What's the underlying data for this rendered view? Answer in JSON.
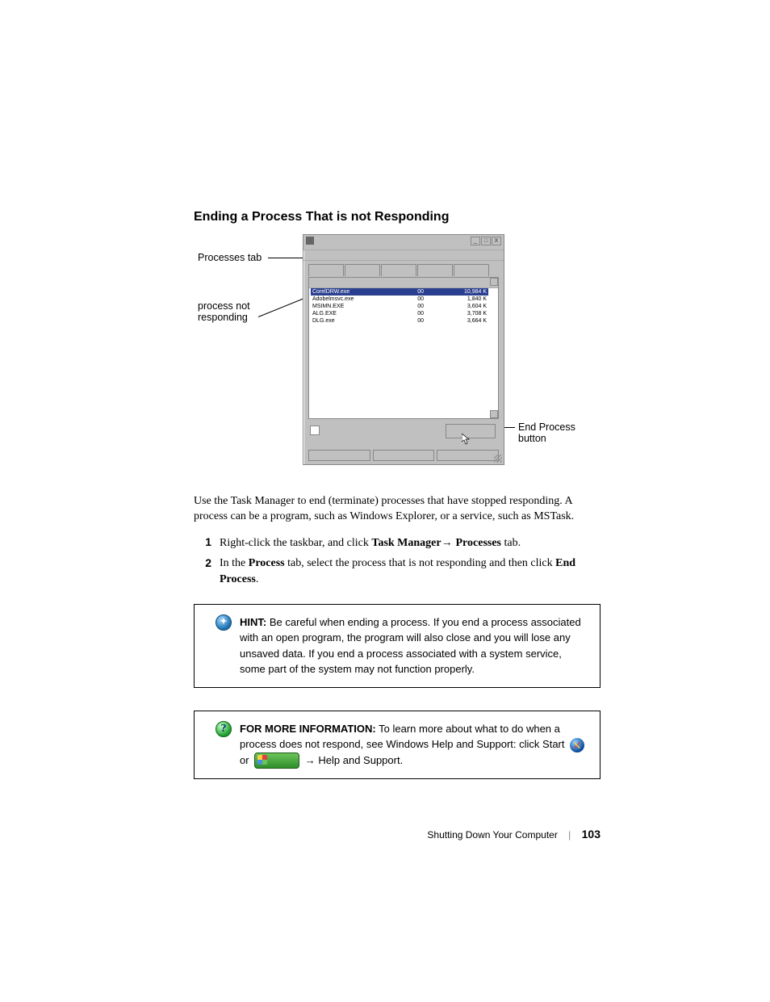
{
  "section_title": "Ending a Process That is not Responding",
  "callouts": {
    "processes_tab": "Processes tab",
    "process_not_responding_l1": "process not",
    "process_not_responding_l2": "responding",
    "end_process_l1": "End Process",
    "end_process_l2": "button"
  },
  "taskmgr": {
    "window_buttons": {
      "min": "_",
      "max": "□",
      "close": "X"
    },
    "rows": [
      {
        "name": "CorelDRW.exe",
        "cpu": "00",
        "mem": "10,984 K",
        "selected": true
      },
      {
        "name": "Adobelmsvc.exe",
        "cpu": "00",
        "mem": "1,840 K",
        "selected": false
      },
      {
        "name": "MSIMN.EXE",
        "cpu": "00",
        "mem": "3,604 K",
        "selected": false
      },
      {
        "name": "ALG.EXE",
        "cpu": "00",
        "mem": "3,708 K",
        "selected": false
      },
      {
        "name": "DLG.exe",
        "cpu": "00",
        "mem": "3,664 K",
        "selected": false
      }
    ]
  },
  "intro_text": "Use the Task Manager to end (terminate) processes that have stopped responding. A process can be a program, such as Windows Explorer, or a service, such as MSTask.",
  "steps": [
    {
      "num": "1",
      "pre": "Right-click the taskbar, and click ",
      "b1": "Task Manager",
      "arrow1": "→ ",
      "b2": "Processes",
      "post": " tab."
    },
    {
      "num": "2",
      "pre": "In the ",
      "b1": "Process",
      "mid": " tab, select the process that is not responding and then click ",
      "b2": "End Process",
      "post": "."
    }
  ],
  "hint": {
    "label": "HINT:",
    "text": " Be careful when ending a process. If you end a process associated with an open program, the program will also close and you will lose any unsaved data. If you end a process associated with a system service, some part of the system may not function properly."
  },
  "moreinfo": {
    "label": "FOR MORE INFORMATION:",
    "text1": " To learn more about what to do when a process does not respond, see Windows Help and Support: click Start ",
    "or": " or ",
    "arrow": " → ",
    "tail": "Help and Support."
  },
  "footer": {
    "chapter": "Shutting Down Your Computer",
    "page": "103"
  }
}
